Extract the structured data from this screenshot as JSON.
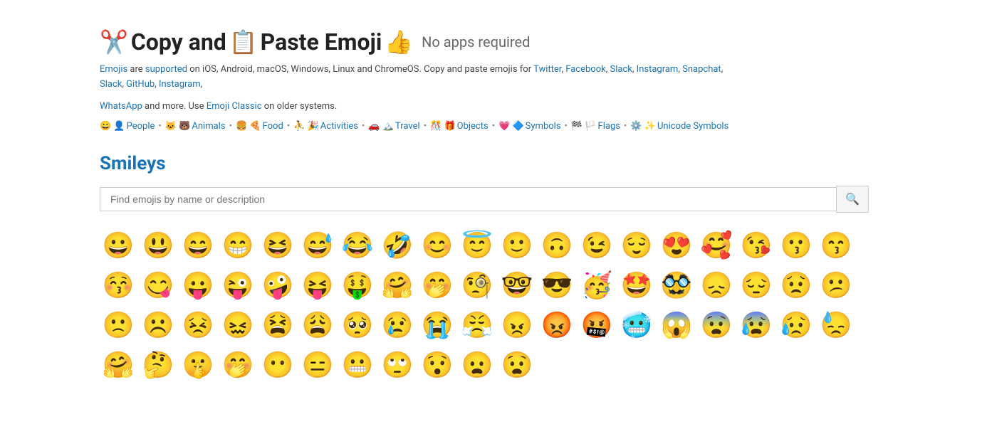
{
  "header": {
    "title_emoji1": "✂️",
    "title_copy": "Copy and",
    "title_emoji2": "📋",
    "title_paste": "Paste Emoji",
    "title_emoji3": "👍",
    "title_no_apps": "No apps required"
  },
  "description": {
    "line1_pre": "Emojis",
    "line1_mid": " are ",
    "line1_supported": "supported",
    "line1_rest": " on iOS, Android, macOS, Windows, Linux and ChromeOS. Copy and paste emojis for ",
    "twitter": "Twitter",
    "sep1": ", ",
    "facebook": "Facebook",
    "sep2": ", ",
    "slack1": "Slack",
    "sep3": ", ",
    "instagram1": "Instagram",
    "sep4": ", ",
    "snapchat": "Snapchat",
    "sep5": ", ",
    "slack2": "Slack",
    "sep6": ", ",
    "github": "GitHub",
    "sep7": ", ",
    "instagram2": "Instagram",
    "sep8": ",",
    "line2_pre": " ",
    "whatsapp": "WhatsApp",
    "line2_mid": " and more. Use ",
    "emoji_classic": "Emoji Classic",
    "line2_rest": " on older systems."
  },
  "nav": {
    "items": [
      {
        "emoji": "😀👤",
        "label": "People",
        "sep": "•"
      },
      {
        "emoji": "🐱🐻",
        "label": "Animals",
        "sep": "•"
      },
      {
        "emoji": "🍔🍕",
        "label": "Food",
        "sep": "•"
      },
      {
        "emoji": "⛹🎉",
        "label": "Activities",
        "sep": "•"
      },
      {
        "emoji": "🚗🏔",
        "label": "Travel",
        "sep": "•"
      },
      {
        "emoji": "🎊🎁",
        "label": "Objects",
        "sep": "•"
      },
      {
        "emoji": "💗🔷",
        "label": "Symbols",
        "sep": "•"
      },
      {
        "emoji": "🏁🏳",
        "label": "Flags",
        "sep": "•"
      },
      {
        "emoji": "⚙✨",
        "label": "Unicode Symbols",
        "sep": ""
      }
    ]
  },
  "smileys": {
    "section_label": "Smileys",
    "search_placeholder": "Find emojis by name or description",
    "row1": [
      "😀",
      "😃",
      "😄",
      "😁",
      "😆",
      "😅",
      "😂",
      "🤣",
      "😊",
      "😇",
      "🙂",
      "🙃",
      "😉",
      "😌",
      "😍",
      "🥰",
      "😘"
    ],
    "row2": [
      "😗",
      "😙",
      "😚",
      "😋",
      "😛",
      "😜",
      "🤪",
      "😝",
      "🤑",
      "🤗",
      "🤭",
      "🧐",
      "🤓",
      "😎",
      "🥳",
      "🤩",
      "🥸"
    ],
    "row3": [
      "😞",
      "😔",
      "😟",
      "😕",
      "🙁",
      "☹️",
      "😣",
      "😖",
      "😫",
      "😩",
      "🥺",
      "😢",
      "😭",
      "😤",
      "😠",
      "😡",
      "🤬"
    ],
    "row4": [
      "🥶",
      "😱",
      "😨",
      "😰",
      "😥",
      "😓",
      "🤗",
      "🤔",
      "🤫",
      "🤭",
      "😶",
      "😑",
      "😬",
      "🙄",
      "😯",
      "😦",
      "😧"
    ]
  }
}
